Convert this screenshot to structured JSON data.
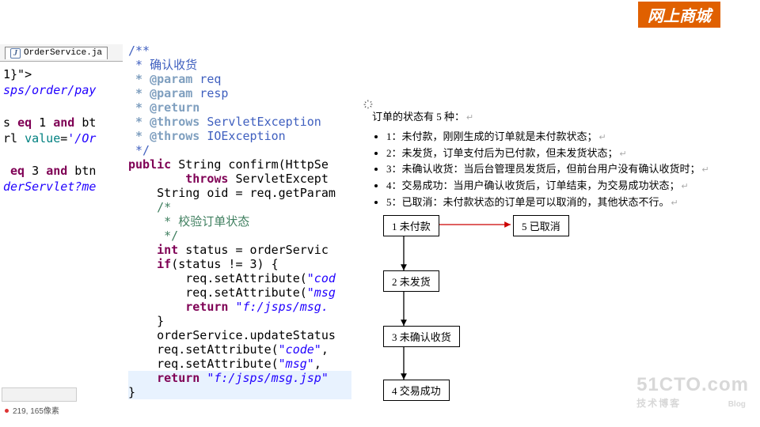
{
  "banner": {
    "text": "网上商城"
  },
  "tabs": {
    "file_icon": "J",
    "filename": "OrderService.ja"
  },
  "left_snippets": {
    "l1": "1}\">",
    "l2_a": "sps/order/pay",
    "l3_a": "s ",
    "l3_eq": "eq",
    "l3_b": " 1 ",
    "l3_and": "and",
    "l3_c": " bt",
    "l4_a": "rl ",
    "l4_val": "value",
    "l4_b": "=",
    "l4_str": "'/Or",
    "l5_a": " ",
    "l5_eq": "eq",
    "l5_b": " 3 ",
    "l5_and": "and",
    "l5_c": " btn",
    "l6": "derServlet?me"
  },
  "code": {
    "jd_open": "/**",
    "jd_l1": " * 确认收货",
    "jd_l2_tag": " * @param",
    "jd_l2_txt": " req",
    "jd_l3_tag": " * @param",
    "jd_l3_txt": " resp",
    "jd_l4_tag": " * @return",
    "jd_l4_txt": "",
    "jd_l5_tag": " * @throws",
    "jd_l5_txt": " ServletException",
    "jd_l6_tag": " * @throws",
    "jd_l6_txt": " IOException",
    "jd_close": " */",
    "m_kw1": "public",
    "m_sig": " String confirm(HttpSe",
    "m_kw2": "throws",
    "m_sig2": " ServletExcept",
    "l_body1a": "    String oid = req.getParam",
    "l_c1": "    /*",
    "l_c2": "     * 校验订单状态",
    "l_c3": "     */",
    "l_int": "    int",
    "l_int_r": " status = orderServic",
    "l_if": "    if",
    "l_if_r": "(status != 3) {",
    "l_r1a": "        req.setAttribute(",
    "l_r1s": "\"cod",
    "l_r2a": "        req.setAttribute(",
    "l_r2s": "\"msg",
    "l_ret": "        return",
    "l_ret_s": " \"f:/jsps/msg.",
    "l_cb": "    }",
    "l_u1": "    orderService.updateStatus",
    "l_u2a": "    req.setAttribute(",
    "l_u2s": "\"code\"",
    "l_u2c": ", ",
    "l_u3a": "    req.setAttribute(",
    "l_u3s": "\"msg\"",
    "l_u3c": ", ",
    "l_ret2": "    return",
    "l_ret2_s": " \"f:/jsps/msg.jsp\"",
    "l_end": "}"
  },
  "doc": {
    "title": "订单的状态有 5 种：",
    "items": [
      "1：未付款，刚刚生成的订单就是未付款状态；",
      "2：未发货，订单支付后为已付款，但未发货状态；",
      "3：未确认收货：当后台管理员发货后，但前台用户没有确认收货时；",
      "4：交易成功：当用户确认收货后，订单结束，为交易成功状态；",
      "5：已取消：未付款状态的订单是可以取消的，其他状态不行。"
    ]
  },
  "diagram": {
    "b1": "1 未付款",
    "b2": "2 未发货",
    "b3": "3 未确认收货",
    "b4": "4 交易成功",
    "b5": "5 已取消"
  },
  "status": {
    "coords": "219, 165像素"
  },
  "watermark": {
    "line1": "51CTO.com",
    "line2": "技术博客",
    "line3": "Blog"
  }
}
